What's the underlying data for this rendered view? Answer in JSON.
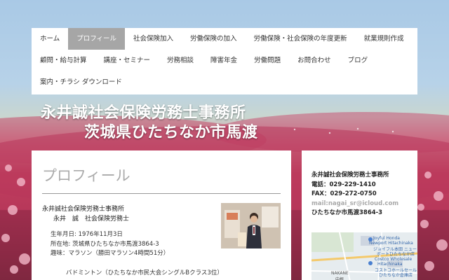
{
  "nav": {
    "row1": [
      "ホーム",
      "プロフィール",
      "社会保険加入",
      "労働保険の加入",
      "労働保険・社会保険の年度更新",
      "就業規則作成"
    ],
    "row2": [
      "顧問・給与計算",
      "講座・セミナー",
      "労務相談",
      "障害年金",
      "労働問題",
      "お問合わせ",
      "ブログ"
    ],
    "row3": [
      "案内・チラシ ダウンロード"
    ],
    "active": "プロフィール"
  },
  "site_title": {
    "line1": "永井誠社会保険労務士事務所",
    "line2": "茨城県ひたちなか市馬渡"
  },
  "main": {
    "title": "プロフィール",
    "office_name": "永井誠社会保険労務士事務所",
    "person_name": "永井　誠　社会保険労務士",
    "birthday": "生年月日: 1976年11月3日",
    "address": "所在地: 茨城県ひたちなか市馬渡3864-3",
    "hobby1": "趣味：マラソン（勝田マラソン4時間51分）",
    "hobby2": "バドミントン（ひたちなか市民大会シングルBクラス3位）"
  },
  "sidebar": {
    "office_name": "永井誠社会保険労務士事務所",
    "phone": "電話：029-229-1410",
    "fax": "FAX：029-272-0750",
    "email": "mail:nagai_sr@icloud.com",
    "address": "ひたちなか市馬渡3864-3",
    "map_labels": {
      "joyful": "Joyful Honda",
      "newport": "Newport Hitachinaka",
      "joyful_jp": "ジョイフル本田 ニュー",
      "joyful_jp2": "ポートひたちなか店",
      "costco": "Costco Wholesale",
      "costco2": "Hitachinaka",
      "costco_jp": "コストコホールセール",
      "costco_jp2": "ひたちなか倉庫店",
      "nakane": "NAKANE",
      "nakane_jp": "中根"
    }
  },
  "colors": {
    "nav_active_bg": "#a6a6a6",
    "title_text": "#ffffff",
    "page_title": "#aaaaaa"
  }
}
